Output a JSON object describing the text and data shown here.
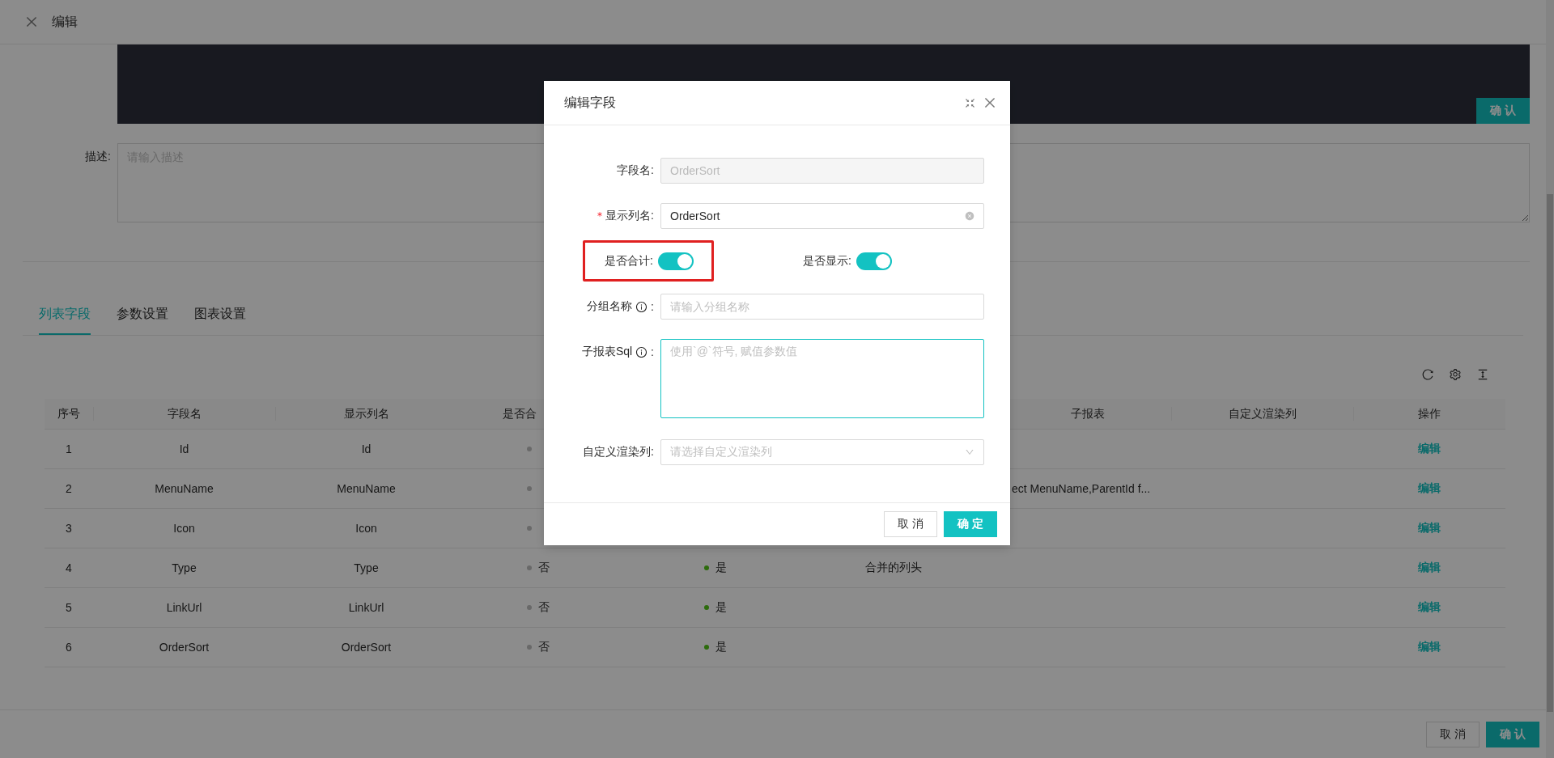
{
  "header": {
    "title": "编辑"
  },
  "editor": {
    "confirm": "确 认"
  },
  "description": {
    "label": "描述:",
    "placeholder": "请输入描述"
  },
  "tabs": [
    {
      "label": "列表字段",
      "selected": true
    },
    {
      "label": "参数设置",
      "selected": false
    },
    {
      "label": "图表设置",
      "selected": false
    }
  ],
  "table": {
    "columns": [
      {
        "label": "序号"
      },
      {
        "label": "字段名"
      },
      {
        "label": "显示列名"
      },
      {
        "label": "是否合"
      },
      {},
      {},
      {
        "label": "子报表"
      },
      {
        "label": "自定义渲染列"
      },
      {
        "label": "操作"
      }
    ],
    "rows": [
      {
        "index": "1",
        "field": "Id",
        "display": "Id",
        "sum": {
          "color": "#696969"
        },
        "action": "编辑"
      },
      {
        "index": "2",
        "field": "MenuName",
        "display": "MenuName",
        "sum": {
          "color": "#696969"
        },
        "sub_report": "ect MenuName,ParentId f...",
        "action": "编辑"
      },
      {
        "index": "3",
        "field": "Icon",
        "display": "Icon",
        "sum": {
          "color": "#696969"
        },
        "action": "编辑"
      },
      {
        "index": "4",
        "field": "Type",
        "display": "Type",
        "sum": {
          "text": "否",
          "color": "#696969"
        },
        "show": {
          "text": "是",
          "color": "#2d6c0e"
        },
        "group": "合并的列头",
        "action": "编辑"
      },
      {
        "index": "5",
        "field": "LinkUrl",
        "display": "LinkUrl",
        "sum": {
          "text": "否",
          "color": "#696969"
        },
        "show": {
          "text": "是",
          "color": "#2d6c0e"
        },
        "action": "编辑"
      },
      {
        "index": "6",
        "field": "OrderSort",
        "display": "OrderSort",
        "sum": {
          "text": "否",
          "color": "#696969"
        },
        "show": {
          "text": "是",
          "color": "#2d6c0e"
        },
        "action": "编辑"
      }
    ]
  },
  "footer": {
    "buttons": [
      {
        "label": "取 消",
        "kind": "default"
      },
      {
        "label": "确 认",
        "kind": "primary"
      }
    ]
  },
  "dialog": {
    "title": "编辑字段",
    "fields": [
      {
        "kind": "input",
        "label": "字段名:",
        "value": "OrderSort",
        "disabled": true
      },
      {
        "kind": "input",
        "label": "显示列名:",
        "required_mark": "*",
        "value": "OrderSort",
        "clearable": true
      },
      {
        "kind": "switches",
        "items": [
          {
            "label": "是否合计:",
            "on": true,
            "highlighted": true
          },
          {
            "label": "是否显示:",
            "on": true,
            "highlighted": false
          }
        ]
      },
      {
        "kind": "input",
        "label": "分组名称",
        "info": true,
        "colon": ":",
        "placeholder": "请输入分组名称"
      },
      {
        "kind": "textarea",
        "label": "子报表Sql",
        "info": true,
        "colon": ":",
        "placeholder": "使用`@`符号, 赋值参数值",
        "focused": true
      },
      {
        "kind": "select",
        "label": "自定义渲染列:",
        "placeholder": "请选择自定义渲染列"
      }
    ],
    "buttons": [
      {
        "label": "取 消",
        "kind": "default"
      },
      {
        "label": "确 定",
        "kind": "primary"
      }
    ]
  }
}
